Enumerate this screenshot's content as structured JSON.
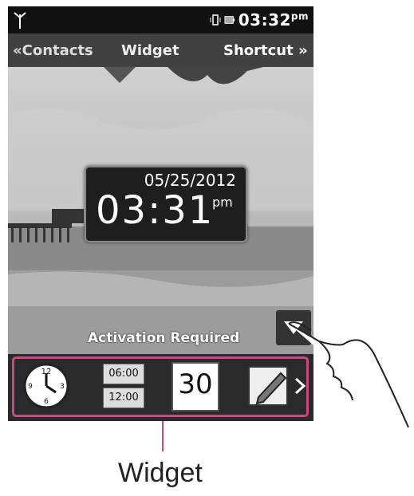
{
  "status_bar": {
    "time": "03:32",
    "ampm": "pm"
  },
  "tabs": {
    "left": "«Contacts",
    "center": "Widget",
    "right": "Shortcut »"
  },
  "clock_widget": {
    "date": "05/25/2012",
    "time": "03:31",
    "ampm": "pm"
  },
  "activation_text": "Activation Required",
  "dock": {
    "alarm_times": [
      "06:00",
      "12:00"
    ],
    "calendar_day": "30",
    "clock_numbers": [
      "12",
      "3",
      "6",
      "9"
    ]
  },
  "callout_label": "Widget",
  "colors": {
    "frame": "#c94a7f"
  }
}
